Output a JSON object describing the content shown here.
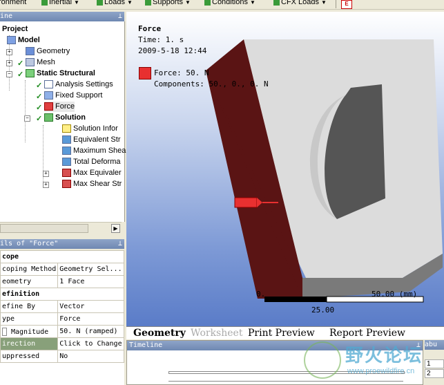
{
  "toolbar": {
    "items": [
      "ronment",
      "Inertial",
      "Loads",
      "Supports",
      "Conditions",
      "CFX Loads"
    ]
  },
  "tree": {
    "title": "ine",
    "nodes": {
      "project": "Project",
      "model": "Model",
      "geometry": "Geometry",
      "mesh": "Mesh",
      "static": "Static Structural",
      "analysis": "Analysis Settings",
      "fixed": "Fixed Support",
      "force": "Force",
      "solution": "Solution",
      "sol_info": "Solution Infor",
      "equiv": "Equivalent Str",
      "maxshear": "Maximum Shea",
      "totdef": "Total Deforma",
      "maxequiv": "Max Equivaler",
      "maxshearstr": "Max Shear Str"
    }
  },
  "details": {
    "title": "ils of \"Force\"",
    "rows": [
      {
        "k": "cope",
        "v": "",
        "section": true
      },
      {
        "k": "coping Method",
        "v": "Geometry Sel..."
      },
      {
        "k": "eometry",
        "v": "1 Face"
      },
      {
        "k": "efinition",
        "v": "",
        "section": true
      },
      {
        "k": "efine By",
        "v": "Vector"
      },
      {
        "k": "ype",
        "v": "Force"
      },
      {
        "k": "Magnitude",
        "v": "50. N (ramped)"
      },
      {
        "k": "irection",
        "v": "Click to Change",
        "highlight": true
      },
      {
        "k": "uppressed",
        "v": "No"
      }
    ]
  },
  "viewport": {
    "title": "Force",
    "time": "Time: 1. s",
    "date": "2009-5-18 12:44",
    "legend_label": "Force: 50. N",
    "components": "Components: 50., 0., 0. N",
    "scale_left": "0.",
    "scale_right": "50.00 (mm)",
    "scale_mid": "25.00",
    "colors": {
      "face": "#5a1414",
      "legend": "#e83030"
    }
  },
  "tabs": [
    "Geometry",
    "Worksheet",
    "Print Preview",
    "Report Preview"
  ],
  "timeline": {
    "title": "Timeline"
  },
  "right": {
    "label": "abu",
    "rows": [
      "1",
      "2"
    ]
  },
  "watermark": {
    "main": "野火论坛",
    "url": "www.proewildfire.cn"
  }
}
